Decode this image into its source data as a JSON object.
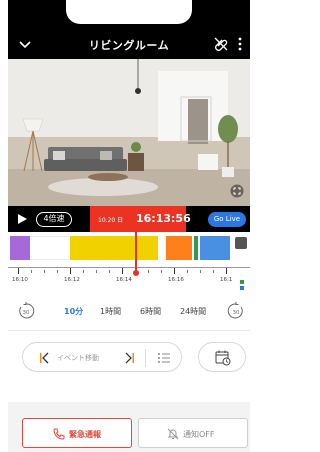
{
  "header": {
    "title": "リビングルーム",
    "back_icon": "chevron-down-icon",
    "link_icon": "paperclip-icon",
    "more_icon": "vertical-dots-icon"
  },
  "player": {
    "speed_label": "4倍速",
    "date": "10.20 日",
    "time": "16:13:56",
    "live_label": "Go Live",
    "fullscreen_icon": "fullscreen-icon"
  },
  "timeline": {
    "tick_labels": [
      "16:10",
      "16:12",
      "16:14",
      "16:16",
      "16:1"
    ],
    "event_colors": {
      "motion": "#a569d8",
      "person": "#f2d100",
      "sound": "#ff7f1a",
      "other": "#2e9a52",
      "live": "#2b78e4"
    }
  },
  "zoom": {
    "options": [
      "10分",
      "1時間",
      "6時間",
      "24時間"
    ],
    "selected": "10分",
    "back_skip_label": "30",
    "forward_skip_label": "30"
  },
  "event_nav": {
    "label": "イベント移動"
  },
  "footer": {
    "emergency_label": "緊急通報",
    "notify_label": "通知OFF"
  },
  "colors": {
    "accent": "#2b78e4",
    "alert": "#ea3323"
  }
}
